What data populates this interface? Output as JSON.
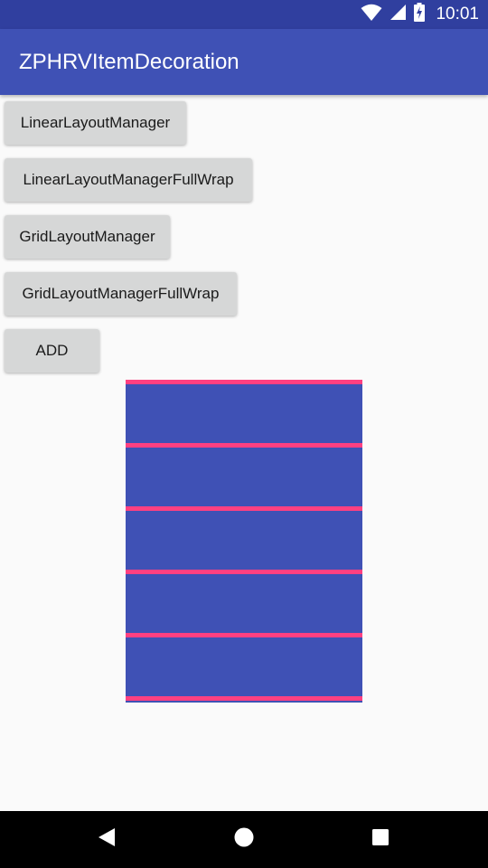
{
  "status_bar": {
    "time": "10:01",
    "icons": [
      "wifi-icon",
      "cell-signal-icon",
      "battery-charging-icon"
    ]
  },
  "app_bar": {
    "title": "ZPHRVItemDecoration"
  },
  "buttons": {
    "linear": "LinearLayoutManager",
    "linear_full_wrap": "LinearLayoutManagerFullWrap",
    "grid": "GridLayoutManager",
    "grid_full_wrap": "GridLayoutManagerFullWrap",
    "add": "ADD"
  },
  "recycler": {
    "item_count": 5,
    "item_color": "#3f51b5",
    "divider_color": "#ff4081"
  },
  "nav_bar": {
    "icons": [
      "back-icon",
      "home-icon",
      "recents-icon"
    ]
  },
  "colors": {
    "primary": "#3f51b5",
    "primary_dark": "#303f9f",
    "accent": "#ff4081",
    "background": "#fafafa",
    "button": "#d6d7d7"
  }
}
